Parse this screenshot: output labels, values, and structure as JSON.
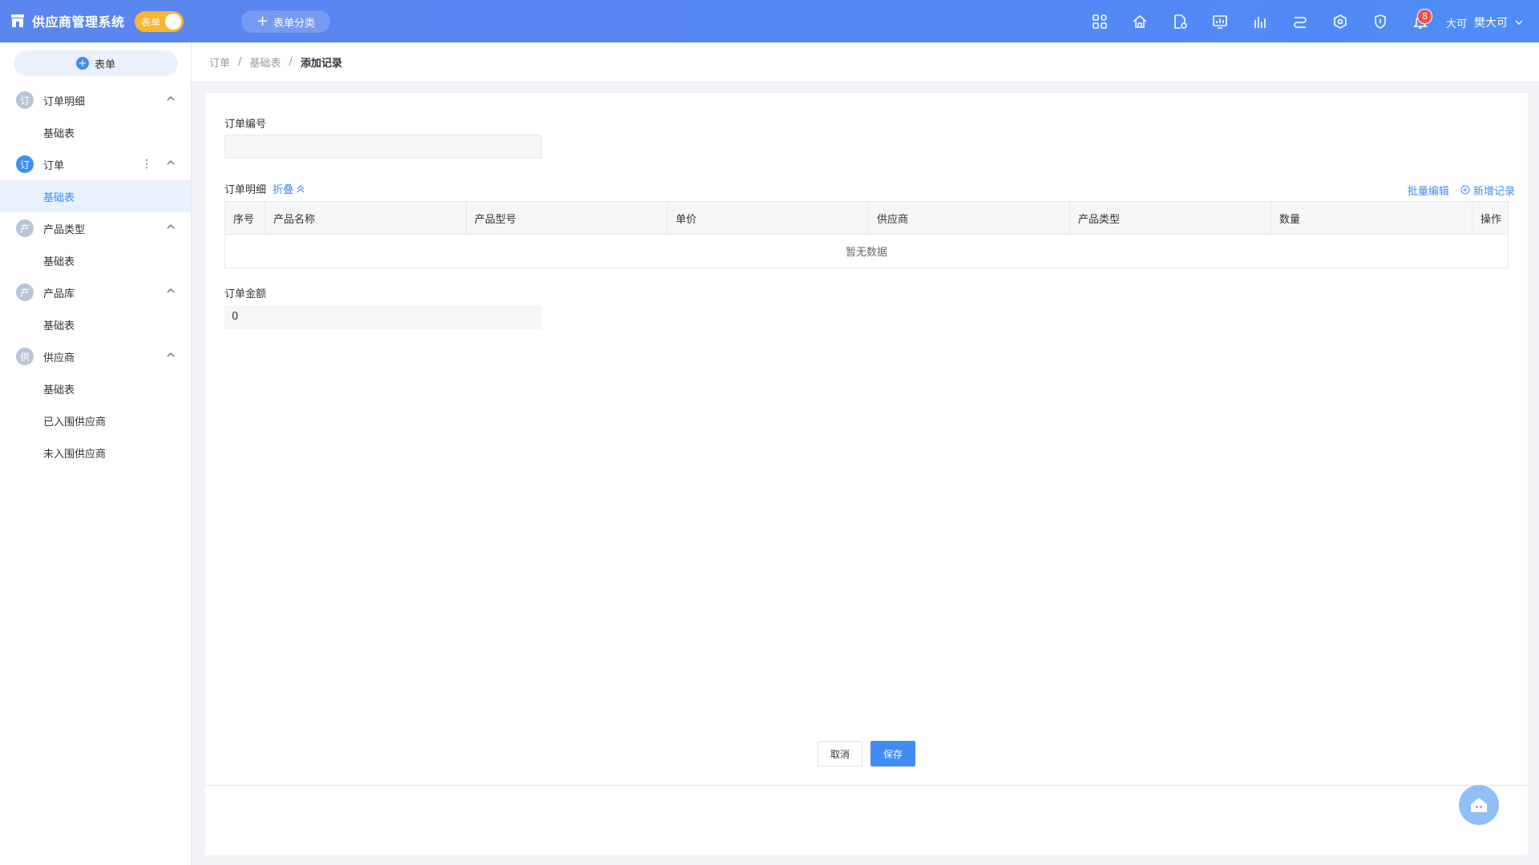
{
  "header": {
    "app_title": "供应商管理系统",
    "toggle_label": "表单",
    "category_button": "表单分类",
    "notification_count": "8",
    "user_avatar_text": "大可",
    "user_name": "樊大可",
    "icons": [
      "apps-icon",
      "home-icon",
      "document-settings-icon",
      "dashboard-icon",
      "chart-icon",
      "flow-icon",
      "hub-icon",
      "shield-icon",
      "bell-icon"
    ]
  },
  "sidebar": {
    "add_button": "表单",
    "groups": [
      {
        "icon_text": "订",
        "label": "订单明细",
        "items": [
          "基础表"
        ]
      },
      {
        "icon_text": "订",
        "label": "订单",
        "items": [
          "基础表"
        ]
      },
      {
        "icon_text": "产",
        "label": "产品类型",
        "items": [
          "基础表"
        ]
      },
      {
        "icon_text": "产",
        "label": "产品库",
        "items": [
          "基础表"
        ]
      },
      {
        "icon_text": "供",
        "label": "供应商",
        "items": [
          "基础表",
          "已入围供应商",
          "未入围供应商"
        ]
      }
    ]
  },
  "breadcrumb": {
    "items": [
      "订单",
      "基础表"
    ],
    "current": "添加记录"
  },
  "form": {
    "order_no_label": "订单编号",
    "order_no_value": "",
    "detail_label": "订单明细",
    "collapse_label": "折叠",
    "batch_edit": "批量编辑",
    "add_record": "新增记录",
    "columns": [
      "序号",
      "产品名称",
      "产品型号",
      "单价",
      "供应商",
      "产品类型",
      "数量",
      "操作"
    ],
    "empty_text": "暂无数据",
    "amount_label": "订单金额",
    "amount_value": "0"
  },
  "buttons": {
    "cancel": "取消",
    "save": "保存"
  },
  "colors": {
    "primary": "#3f8cf5",
    "header_gradient_start": "#5b86ee",
    "toggle": "#f7b733",
    "badge": "#f04e4e"
  }
}
